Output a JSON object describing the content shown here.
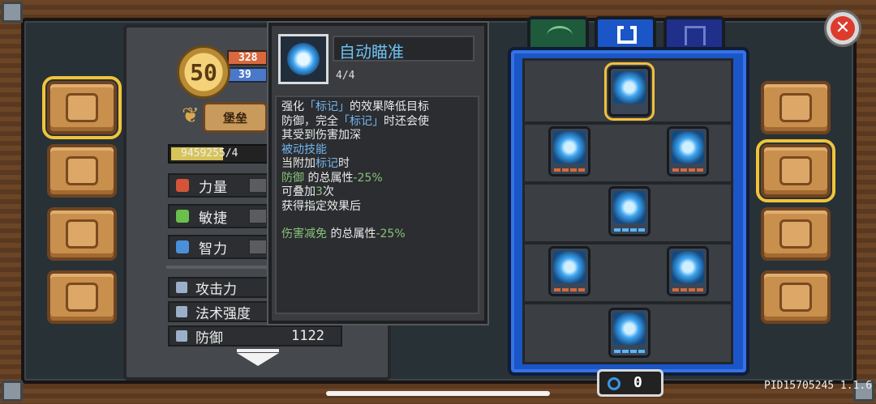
{
  "character": {
    "level": "50",
    "hp": "328",
    "mp": "39",
    "title": "堡垒",
    "xp_text": "9459255/4",
    "xp_progress": 0.55
  },
  "attributes": [
    {
      "label": "力量",
      "icon": "fist-icon",
      "color": "#d4543a"
    },
    {
      "label": "敏捷",
      "icon": "feather-icon",
      "color": "#69c04c"
    },
    {
      "label": "智力",
      "icon": "book-icon",
      "color": "#4a90d9"
    }
  ],
  "combat_stats": [
    {
      "label": "攻击力",
      "value": ""
    },
    {
      "label": "法术强度",
      "value": ""
    },
    {
      "label": "防御",
      "value": "1122"
    }
  ],
  "tooltip": {
    "skill_name": "自动瞄准",
    "skill_level": "4/4",
    "line1a": "强化",
    "line1b": "「标记」",
    "line1c": "的效果降低目标",
    "line2a": "防御，完全",
    "line2b": "「标记」",
    "line2c": "时还会使",
    "line3": "其受到伤害加深",
    "passive": "被动技能",
    "attach_a": "当附加",
    "attach_b": "标记",
    "attach_c": "时",
    "def_a": "防御",
    "def_b": " 的总属性",
    "def_c": "-25%",
    "stack_a": "可叠加",
    "stack_b": "3",
    "stack_c": "次",
    "gain": "获得指定效果后",
    "dmg_a": "伤害减免",
    "dmg_b": " 的总属性",
    "dmg_c": "-25%"
  },
  "skill_tree": {
    "tabs": [
      {
        "name": "bow-tab",
        "icon": "bow-icon",
        "color": "#1f5a3c"
      },
      {
        "name": "fortress-tab",
        "icon": "castle-icon",
        "color": "#1b56c8"
      },
      {
        "name": "gate-tab",
        "icon": "gate-icon",
        "color": "#1f2f8a"
      }
    ],
    "skills": [
      {
        "name": "auto-aim",
        "pips": 0,
        "max": 0
      },
      {
        "name": "skill-2",
        "pips": 0,
        "max": 4
      },
      {
        "name": "skill-3",
        "pips": 0,
        "max": 4
      },
      {
        "name": "skill-4",
        "pips": 4,
        "max": 4
      },
      {
        "name": "skill-5",
        "pips": 0,
        "max": 4
      },
      {
        "name": "skill-6",
        "pips": 0,
        "max": 4
      },
      {
        "name": "skill-7",
        "pips": 4,
        "max": 4
      }
    ],
    "orb_count": "0"
  },
  "close_symbol": "✕",
  "version": "PID15705245 1.1.6",
  "side_left": [
    "book-icon",
    "map-icon",
    "dice-icon",
    "helmet-icon"
  ],
  "side_right": [
    "hood-icon",
    "crossed-swords-icon",
    "star-icon",
    "gear-icon"
  ]
}
